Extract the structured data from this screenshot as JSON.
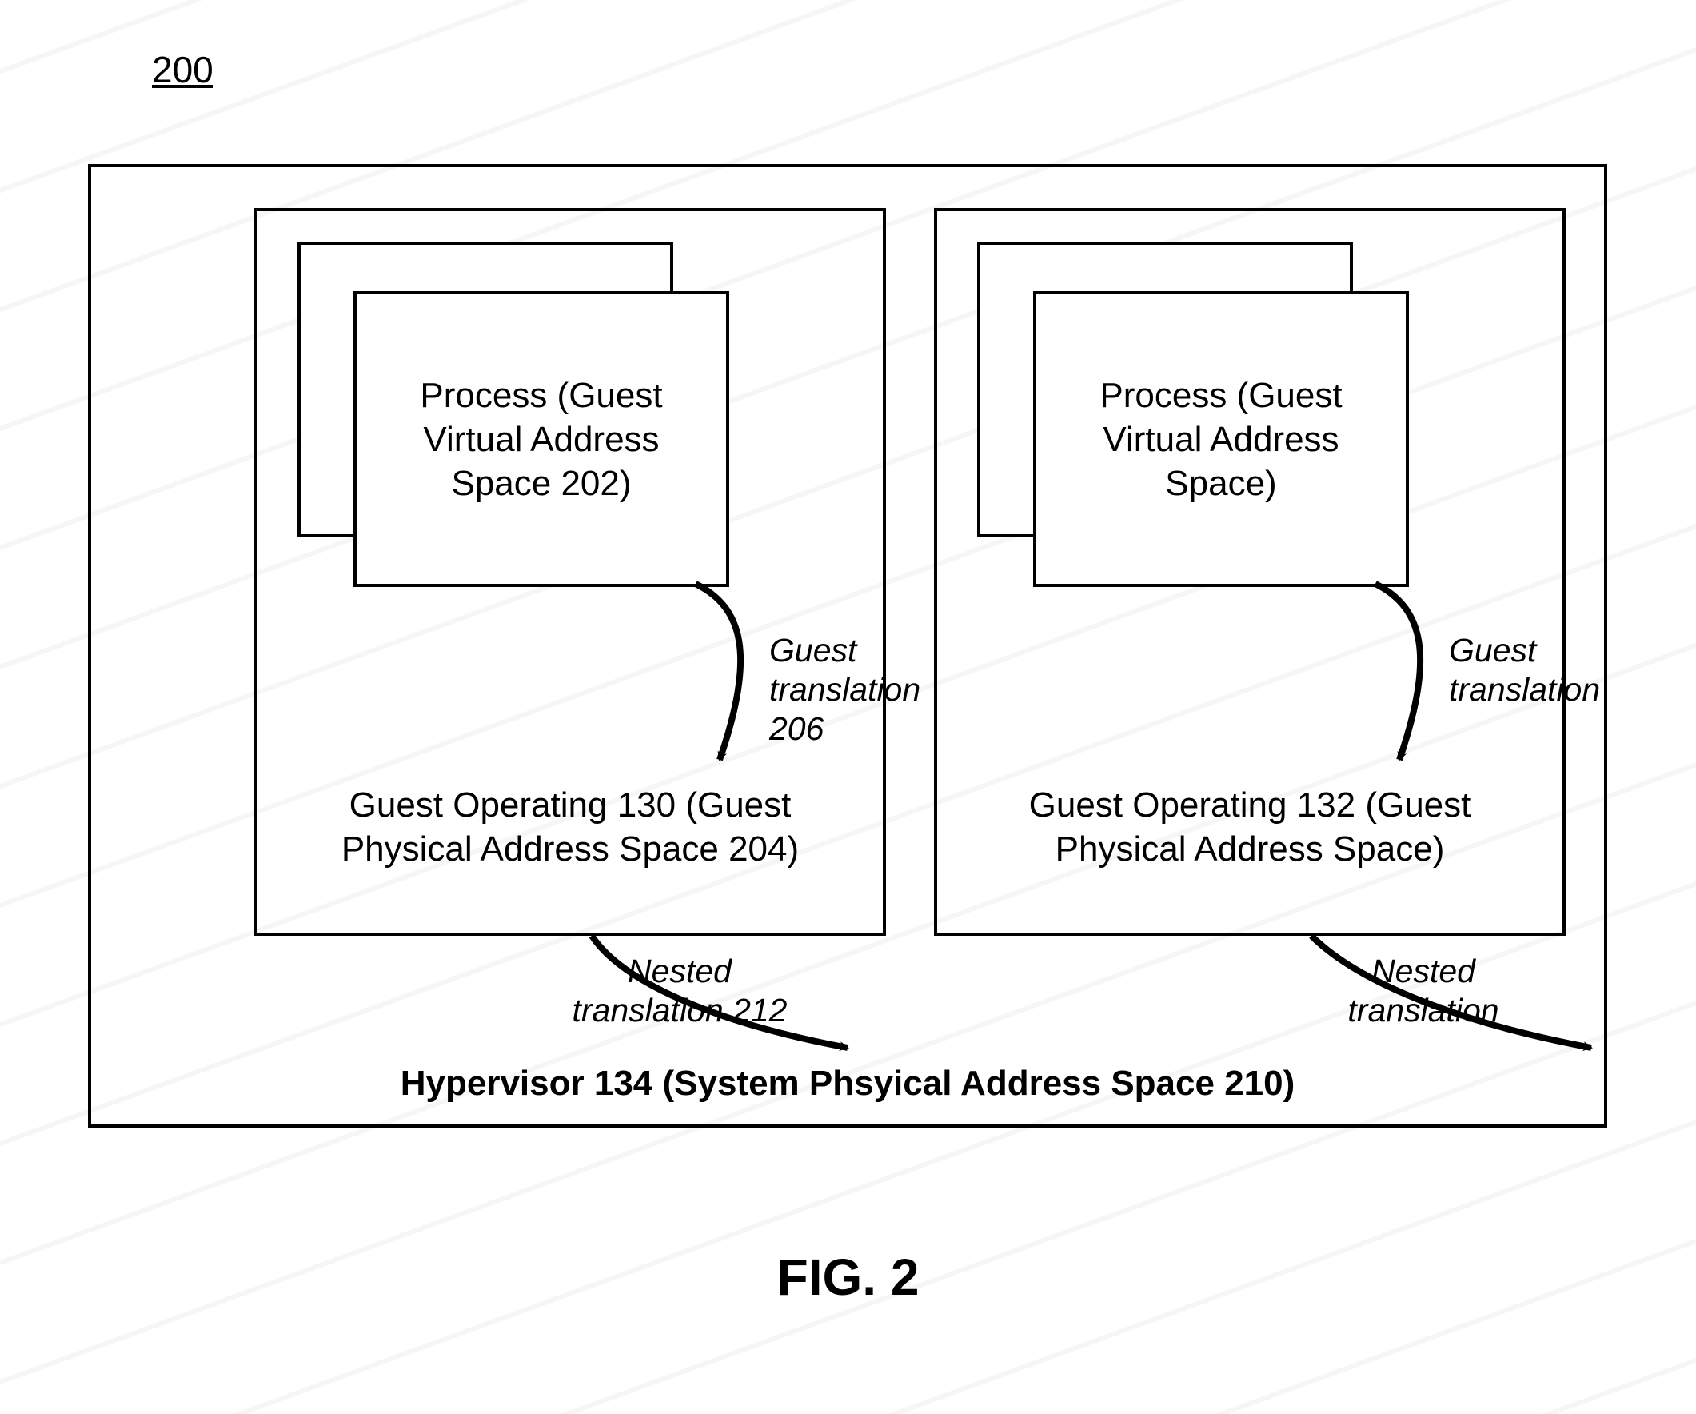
{
  "figure_ref": "200",
  "caption": "FIG. 2",
  "hypervisor": "Hypervisor 134 (System Phsyical Address Space 210)",
  "left": {
    "process": "Process (Guest Virtual Address Space 202)",
    "guest_translation": "Guest translation 206",
    "guest_os": "Guest Operating 130 (Guest Physical Address Space 204)",
    "nested_translation": "Nested translation 212"
  },
  "right": {
    "process": "Process (Guest Virtual Address Space)",
    "guest_translation": "Guest translation",
    "guest_os": "Guest Operating 132 (Guest Physical Address Space)",
    "nested_translation": "Nested translation"
  }
}
